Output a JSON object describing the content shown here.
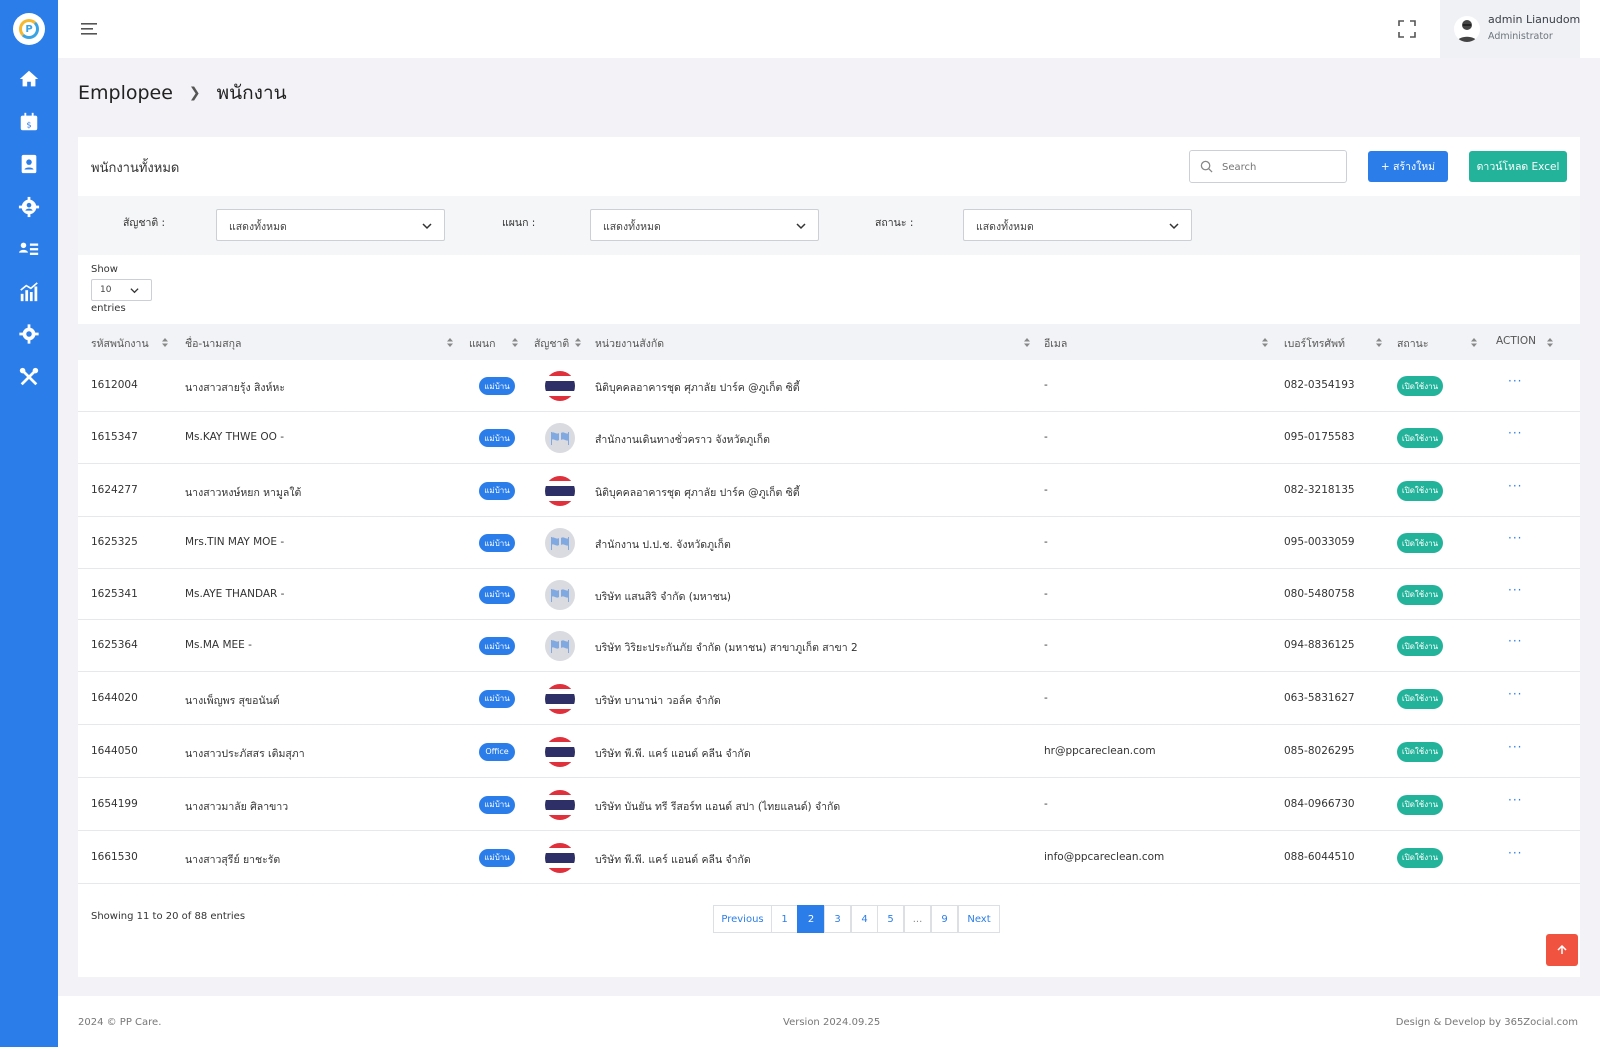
{
  "app": {
    "logo_text": "P"
  },
  "header": {
    "user_name": "admin Lianudom",
    "user_role": "Administrator"
  },
  "breadcrumb": {
    "parent": "Emplopee",
    "current": "พนักงาน"
  },
  "card": {
    "title": "พนักงานทั้งหมด",
    "search_placeholder": "Search",
    "create_label": "+ สร้างใหม่",
    "excel_label": "ดาวน์โหลด Excel"
  },
  "filters": {
    "nationality_label": "สัญชาติ :",
    "nationality_value": "แสดงทั้งหมด",
    "department_label": "แผนก :",
    "department_value": "แสดงทั้งหมด",
    "status_label": "สถานะ :",
    "status_value": "แสดงทั้งหมด"
  },
  "length": {
    "show": "Show",
    "value": "10",
    "entries": "entries"
  },
  "table": {
    "headers": [
      "รหัสพนักงาน",
      "ชื่อ-นามสกุล",
      "แผนก",
      "สัญชาติ",
      "หน่วยงานสังกัด",
      "อีเมล",
      "เบอร์โทรศัพท์",
      "สถานะ",
      "ACTION"
    ],
    "rows": [
      {
        "id": "1612004",
        "name": "นางสาวสายรุ้ง สิงห์หะ",
        "dept": "แม่บ้าน",
        "nat": "thai",
        "unit": "นิติบุคคลอาคารชุด ศุภาลัย ปาร์ค @ภูเก็ต ซิตี้",
        "email": "-",
        "phone": "082-0354193",
        "status": "เปิดใช้งาน",
        "action": "···"
      },
      {
        "id": "1615347",
        "name": "Ms.KAY THWE OO -",
        "dept": "แม่บ้าน",
        "nat": "other",
        "unit": "สำนักงานเดินทางชั่วคราว จังหวัดภูเก็ต",
        "email": "-",
        "phone": "095-0175583",
        "status": "เปิดใช้งาน",
        "action": "···"
      },
      {
        "id": "1624277",
        "name": "นางสาวหงษ์หยก หามูลใต้",
        "dept": "แม่บ้าน",
        "nat": "thai",
        "unit": "นิติบุคคลอาคารชุด ศุภาลัย ปาร์ค @ภูเก็ต ซิตี้",
        "email": "-",
        "phone": "082-3218135",
        "status": "เปิดใช้งาน",
        "action": "···"
      },
      {
        "id": "1625325",
        "name": "Mrs.TIN MAY MOE -",
        "dept": "แม่บ้าน",
        "nat": "other",
        "unit": "สำนักงาน ป.ป.ช. จังหวัดภูเก็ต",
        "email": "-",
        "phone": "095-0033059",
        "status": "เปิดใช้งาน",
        "action": "···"
      },
      {
        "id": "1625341",
        "name": "Ms.AYE THANDAR -",
        "dept": "แม่บ้าน",
        "nat": "other",
        "unit": "บริษัท แสนสิริ จำกัด (มหาชน)",
        "email": "-",
        "phone": "080-5480758",
        "status": "เปิดใช้งาน",
        "action": "···"
      },
      {
        "id": "1625364",
        "name": "Ms.MA MEE -",
        "dept": "แม่บ้าน",
        "nat": "other",
        "unit": "บริษัท วิริยะประกันภัย จำกัด (มหาชน) สาขาภูเก็ต สาขา 2",
        "email": "-",
        "phone": "094-8836125",
        "status": "เปิดใช้งาน",
        "action": "···"
      },
      {
        "id": "1644020",
        "name": "นางเพ็ญพร สุขอนันต์",
        "dept": "แม่บ้าน",
        "nat": "thai",
        "unit": "บริษัท บานาน่า วอล์ค จำกัด",
        "email": "-",
        "phone": "063-5831627",
        "status": "เปิดใช้งาน",
        "action": "···"
      },
      {
        "id": "1644050",
        "name": "นางสาวประภัสสร เติมสุภา",
        "dept": "Office",
        "nat": "thai",
        "unit": "บริษัท พี.พี. แคร์ แอนด์ คลีน จำกัด",
        "email": "hr@ppcareclean.com",
        "phone": "085-8026295",
        "status": "เปิดใช้งาน",
        "action": "···"
      },
      {
        "id": "1654199",
        "name": "นางสาวมาลัย ศิลาขาว",
        "dept": "แม่บ้าน",
        "nat": "thai",
        "unit": "บริษัท บันยัน ทรี รีสอร์ท แอนด์ สปา (ไทยแลนด์) จำกัด",
        "email": "-",
        "phone": "084-0966730",
        "status": "เปิดใช้งาน",
        "action": "···"
      },
      {
        "id": "1661530",
        "name": "นางสาวสุรีย์ ยาชะรัต",
        "dept": "แม่บ้าน",
        "nat": "thai",
        "unit": "บริษัท พี.พี. แคร์ แอนด์ คลีน จำกัด",
        "email": "info@ppcareclean.com",
        "phone": "088-6044510",
        "status": "เปิดใช้งาน",
        "action": "···"
      }
    ]
  },
  "pagination": {
    "info": "Showing 11 to 20 of 88 entries",
    "items": [
      "Previous",
      "1",
      "2",
      "3",
      "4",
      "5",
      "...",
      "9",
      "Next"
    ],
    "active": "2"
  },
  "footer": {
    "copyright": "2024 © PP Care.",
    "version": "Version 2024.09.25",
    "credit": "Design & Develop by 365Zocial.com"
  },
  "colors": {
    "primary": "#2b7de9",
    "success": "#22b39a",
    "danger": "#f0533f"
  },
  "icons": [
    "menu-icon",
    "fullscreen-icon",
    "avatar",
    "home-icon",
    "calendar-dollar-icon",
    "contact-book-icon",
    "users-gear-icon",
    "list-users-icon",
    "chart-icon",
    "gear-icon",
    "tools-icon",
    "search-icon",
    "chevron-down-icon",
    "arrow-up-icon"
  ]
}
